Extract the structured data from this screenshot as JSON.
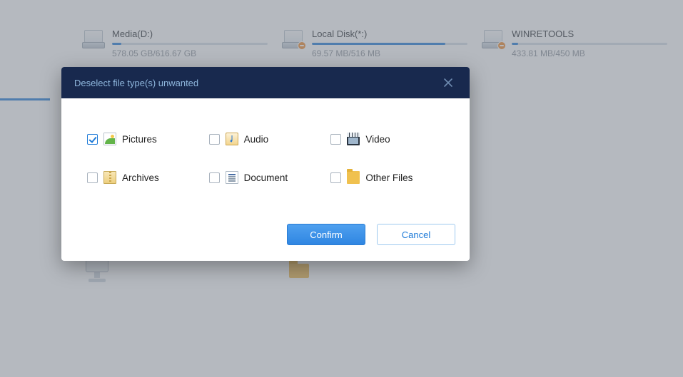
{
  "drives": [
    {
      "name": "Media(D:)",
      "size": "578.05 GB/616.67 GB",
      "fill_pct": 6,
      "badge": false
    },
    {
      "name": "Local Disk(*:)",
      "size": "69.57 MB/516 MB",
      "fill_pct": 86,
      "badge": true
    },
    {
      "name": "WINRETOOLS",
      "size": "433.81 MB/450 MB",
      "fill_pct": 4,
      "badge": true
    }
  ],
  "dialog": {
    "title": "Deselect file type(s) unwanted",
    "confirm_label": "Confirm",
    "cancel_label": "Cancel",
    "types": [
      {
        "label": "Pictures",
        "icon": "pictures",
        "checked": true
      },
      {
        "label": "Audio",
        "icon": "audio",
        "checked": false
      },
      {
        "label": "Video",
        "icon": "video",
        "checked": false
      },
      {
        "label": "Archives",
        "icon": "archives",
        "checked": false
      },
      {
        "label": "Document",
        "icon": "document",
        "checked": false
      },
      {
        "label": "Other Files",
        "icon": "other",
        "checked": false
      }
    ]
  }
}
